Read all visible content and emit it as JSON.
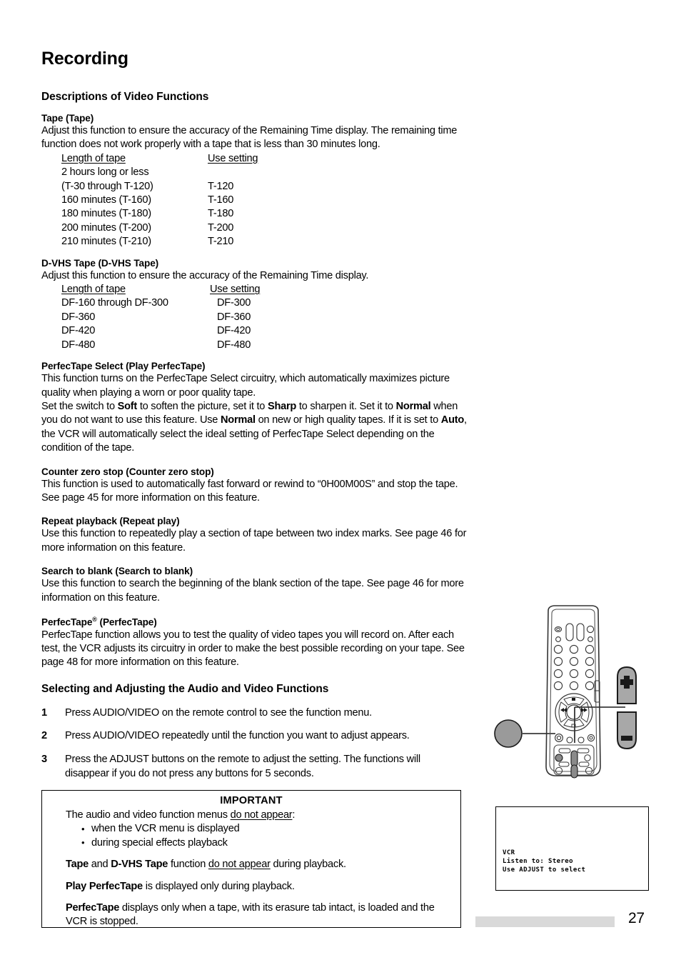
{
  "page": {
    "title": "Recording",
    "number": "27"
  },
  "sections": {
    "video_functions": {
      "heading": "Descriptions of Video Functions",
      "items": [
        {
          "title": "Tape (Tape)",
          "body": "Adjust this function to ensure the accuracy of the Remaining Time display.  The remaining time function does not work properly with a tape that is less than 30 minutes long."
        },
        {
          "title": "D-VHS Tape (D-VHS Tape)",
          "body": "Adjust this function to ensure the accuracy of the Remaining Time display."
        }
      ]
    },
    "tape_table": {
      "col1_header": "Length of tape",
      "col2_header": "Use setting",
      "rows": [
        {
          "length": "2 hours long or less",
          "setting": ""
        },
        {
          "length": "(T-30 through T-120)",
          "setting": "T-120"
        },
        {
          "length": "160 minutes (T-160)",
          "setting": "T-160"
        },
        {
          "length": "180 minutes (T-180)",
          "setting": "T-180"
        },
        {
          "length": "200 minutes (T-200)",
          "setting": "T-200"
        },
        {
          "length": "210 minutes (T-210)",
          "setting": "T-210"
        }
      ]
    },
    "dvhs_table": {
      "col1_header": "Length of tape",
      "col2_header": "Use setting",
      "rows": [
        {
          "length": "DF-160 through DF-300",
          "setting": "DF-300"
        },
        {
          "length": "DF-360",
          "setting": "DF-360"
        },
        {
          "length": "DF-420",
          "setting": "DF-420"
        },
        {
          "length": "DF-480",
          "setting": "DF-480"
        }
      ]
    },
    "perfectape_select": {
      "title": "PerfecTape Select (Play PerfecTape)",
      "line1": "This function turns on the PerfecTape Select circuitry, which automatically maximizes picture quality when playing a worn or poor quality tape.",
      "line2_a": "Set the switch to ",
      "bold_soft": "Soft",
      "line2_b": " to soften the picture, set it to ",
      "bold_sharp": "Sharp",
      "line2_c": " to sharpen it.  Set it to ",
      "bold_normal1": "Normal",
      "line2_d": " when you do not want to use this feature.  Use ",
      "bold_normal2": "Normal",
      "line2_e": " on new or high quality tapes.  If it is set to ",
      "bold_auto": "Auto",
      "line2_f": ", the VCR will automatically select the ideal setting of PerfecTape Select depending on the condition of the tape."
    },
    "counter_zero_stop": {
      "title": "Counter zero stop (Counter zero stop)",
      "body": "This function is used to automatically fast forward or rewind to “0H00M00S” and stop the tape.  See page 45 for more information on this feature."
    },
    "repeat_playback": {
      "title": "Repeat playback (Repeat play)",
      "body": "Use this function to repeatedly play a section of tape between two index marks.  See page 46 for more information on this feature."
    },
    "search_to_blank": {
      "title": "Search to blank (Search to blank)",
      "body": "Use this function to search the beginning of the blank section of the tape.  See page 46 for more information on this feature."
    },
    "perfectape": {
      "title_a": "PerfecTape",
      "title_reg": "®",
      "title_b": " (PerfecTape)",
      "body": "PerfecTape function allows you to test the quality of video tapes you will record on.  After each test, the VCR adjusts its circuitry in order to make the best possible recording on your tape.  See page 48 for more information on this feature."
    },
    "selecting": {
      "heading": "Selecting and Adjusting the Audio and Video Functions",
      "steps": [
        {
          "num": "1",
          "text": "Press AUDIO/VIDEO on the remote control to see the function menu."
        },
        {
          "num": "2",
          "text": "Press AUDIO/VIDEO repeatedly until the function you want to adjust appears."
        },
        {
          "num": "3",
          "text": "Press the ADJUST buttons on the remote to adjust the setting.  The functions will disappear if you do not press any buttons for 5 seconds."
        }
      ]
    },
    "important": {
      "title": "IMPORTANT",
      "intro_a": "The audio and video function menus ",
      "intro_u": "do not appear",
      "intro_b": ":",
      "bullets": [
        "when the VCR menu is displayed",
        "during special effects playback"
      ],
      "note1_bold1": "Tape",
      "note1_mid": " and ",
      "note1_bold2": "D-VHS Tape",
      "note1_a": " function ",
      "note1_u": "do not appear",
      "note1_b": " during playback.",
      "note2_bold": "Play PerfecTape",
      "note2_text": " is displayed only during playback.",
      "note3_bold": "PerfecTape",
      "note3_text": " displays only when a tape, with its erasure tab intact, is loaded and the VCR is stopped."
    }
  },
  "illustration": {
    "remote_label": "remote-control-illustration",
    "callouts": {
      "record_button": "record-button-callout",
      "plus_button": "+",
      "minus_button": "−"
    }
  },
  "osd": {
    "line1": "VCR",
    "line2": "Listen to: Stereo",
    "line3": "Use ADJUST to select"
  }
}
